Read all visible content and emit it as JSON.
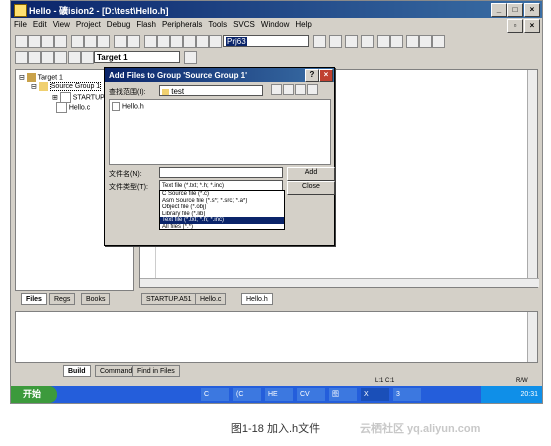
{
  "window": {
    "title": "Hello  - 礦ision2 - [D:\\test\\Hello.h]"
  },
  "menu": [
    "File",
    "Edit",
    "View",
    "Project",
    "Debug",
    "Flash",
    "Peripherals",
    "Tools",
    "SVCS",
    "Window",
    "Help"
  ],
  "toolbar": {
    "find_combo": "Prj63",
    "target_combo": "Target 1"
  },
  "project_tree": {
    "root": "Target 1",
    "group": "Source Group 1",
    "files": [
      "STARTUP.A51",
      "Hello.c"
    ]
  },
  "left_tabs": [
    "Files",
    "Regs",
    "Books"
  ],
  "editor_tabs": [
    "STARTUP.A51",
    "Hello.c",
    "Hello.h"
  ],
  "output_tabs": [
    "Build",
    "Command",
    "Find in Files"
  ],
  "status": {
    "position": "L:1 C:1",
    "mode": "R/W"
  },
  "dialog": {
    "title": "Add Files to Group 'Source Group 1'",
    "look_in_label": "查找范围(I):",
    "look_in_value": "test",
    "file_list": [
      "Hello.h"
    ],
    "filename_label": "文件名(N):",
    "filename_value": "",
    "filetype_label": "文件类型(T):",
    "filetype_value": "Text file (*.txt; *.h; *.inc)",
    "add_button": "Add",
    "close_button": "Close",
    "filetype_options": [
      "C Source file (*.c)",
      "Asm Source file (*.s*; *.src; *.a*)",
      "Object file (*.obj)",
      "Library file (*.lib)",
      "Text file (*.txt; *.h; *.inc)",
      "All files (*.*)"
    ],
    "selected_index": 4
  },
  "taskbar": {
    "start_label": "开始",
    "items": [
      "C",
      "(C",
      "HE",
      "CV",
      "图",
      "X",
      "3"
    ],
    "clock": "20:31"
  },
  "watermark": "云栖社区 yq.aliyun.com",
  "caption": "图1-18 加入.h文件"
}
